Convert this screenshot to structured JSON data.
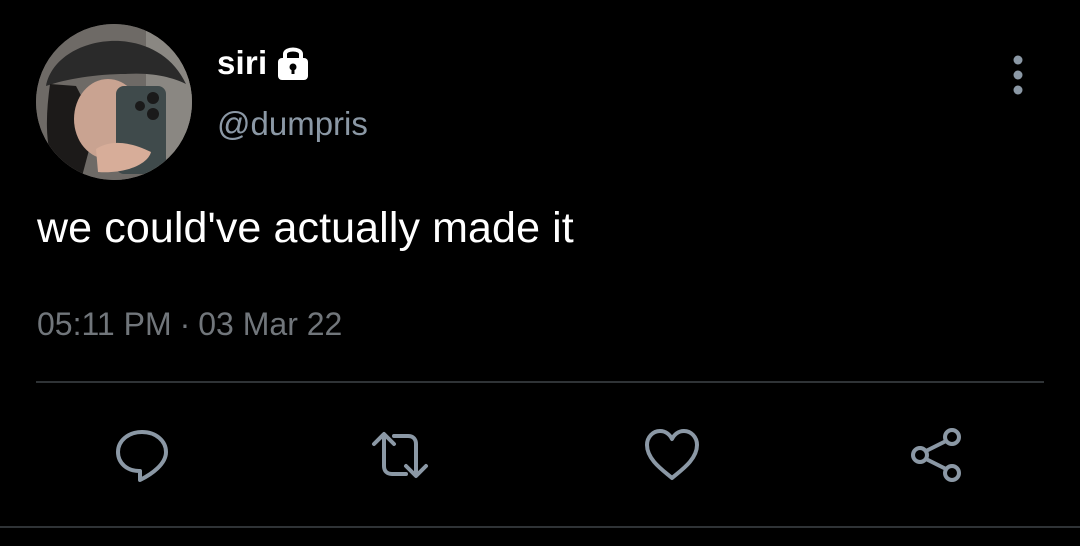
{
  "user": {
    "display_name": "siri",
    "handle": "@dumpris",
    "avatar": "profile-photo",
    "protected_icon": "lock-icon"
  },
  "tweet": {
    "text": "we could've actually made it",
    "time": "05:11 PM",
    "separator": "·",
    "date": "03 Mar 22"
  },
  "actions": [
    {
      "name": "reply",
      "icon": "reply-icon"
    },
    {
      "name": "retweet",
      "icon": "retweet-icon"
    },
    {
      "name": "like",
      "icon": "heart-icon"
    },
    {
      "name": "share",
      "icon": "share-icon"
    }
  ],
  "menu": {
    "icon": "more-vertical-icon"
  },
  "colors": {
    "background": "#000000",
    "primary_text": "#ffffff",
    "secondary_text": "#71767b",
    "icon": "#8b98a5",
    "divider": "#2f3336"
  }
}
